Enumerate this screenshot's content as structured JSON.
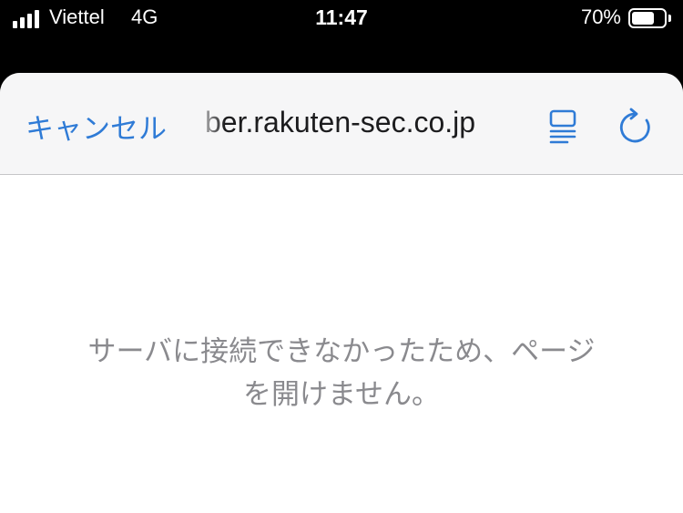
{
  "status_bar": {
    "carrier": "Viettel",
    "network": "4G",
    "time": "11:47",
    "battery_percent_text": "70%",
    "battery_level": 0.7,
    "signal_bars": 4
  },
  "navbar": {
    "cancel_label": "キャンセル",
    "url": "ber.rakuten-sec.co.jp",
    "accent_color": "#2f7bd6"
  },
  "error": {
    "message": "サーバに接続できなかったため、ページを開けません。"
  }
}
